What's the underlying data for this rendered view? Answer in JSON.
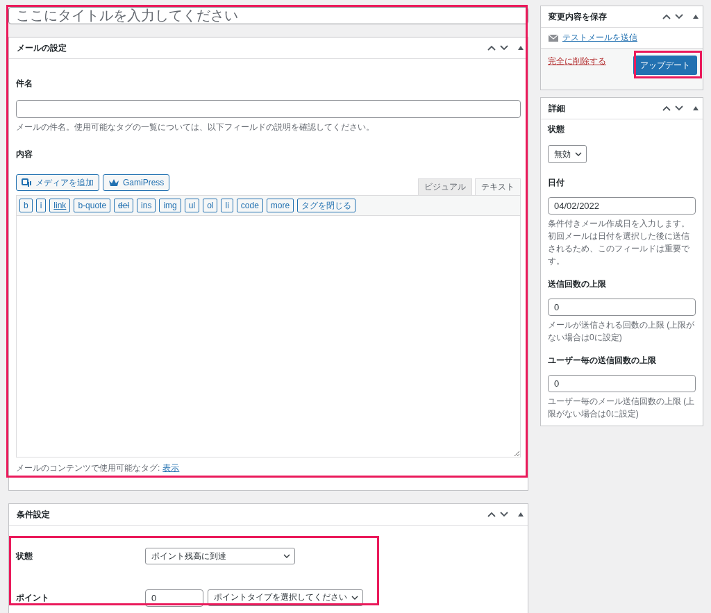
{
  "title_field": {
    "placeholder": "ここにタイトルを入力してください"
  },
  "mail_panel": {
    "title": "メールの設定",
    "subject_label": "件名",
    "subject_help": "メールの件名。使用可能なタグの一覧については、以下フィールドの説明を確認してください。",
    "content_label": "内容",
    "media_buttons": [
      {
        "kind": "media",
        "label": "メディアを追加"
      },
      {
        "kind": "crown",
        "label": "GamiPress"
      }
    ],
    "editor_tabs": [
      {
        "label": "ビジュアル",
        "selected": false
      },
      {
        "label": "テキスト",
        "selected": true
      }
    ],
    "quicktags": [
      {
        "label": "b",
        "kind": "plain"
      },
      {
        "label": "i",
        "kind": "plain"
      },
      {
        "label": "link",
        "kind": "underline"
      },
      {
        "label": "b-quote",
        "kind": "plain"
      },
      {
        "label": "del",
        "kind": "strike"
      },
      {
        "label": "ins",
        "kind": "plain"
      },
      {
        "label": "img",
        "kind": "plain"
      },
      {
        "label": "ul",
        "kind": "plain"
      },
      {
        "label": "ol",
        "kind": "plain"
      },
      {
        "label": "li",
        "kind": "plain"
      },
      {
        "label": "code",
        "kind": "plain"
      },
      {
        "label": "more",
        "kind": "plain"
      },
      {
        "label": "タグを閉じる",
        "kind": "plain"
      }
    ],
    "tags_text": "メールのコンテンツで使用可能なタグ:",
    "tags_link": "表示"
  },
  "condition_panel": {
    "title": "条件設定",
    "rows": [
      {
        "kind": "select",
        "label": "状態",
        "value": "ポイント残高に到達"
      },
      {
        "kind": "points",
        "label": "ポイント",
        "value": "0",
        "select": "ポイントタイプを選択してください"
      }
    ]
  },
  "save_panel": {
    "title": "変更内容を保存",
    "test_link": "テストメールを送信",
    "delete_link": "完全に削除する",
    "update_button": "アップデート"
  },
  "details_panel": {
    "title": "詳細",
    "fields": [
      {
        "kind": "select",
        "label": "状態",
        "value": "無効"
      },
      {
        "kind": "input",
        "label": "日付",
        "value": "04/02/2022",
        "help": "条件付きメール作成日を入力します。初回メールは日付を選択した後に送信されるため、このフィールドは重要です。"
      },
      {
        "kind": "input",
        "label": "送信回数の上限",
        "value": "0",
        "help": "メールが送信される回数の上限 (上限がない場合は0に設定)"
      },
      {
        "kind": "input",
        "label": "ユーザー毎の送信回数の上限",
        "value": "0",
        "help": "ユーザー毎のメール送信回数の上限 (上限がない場合は0に設定)"
      }
    ]
  }
}
